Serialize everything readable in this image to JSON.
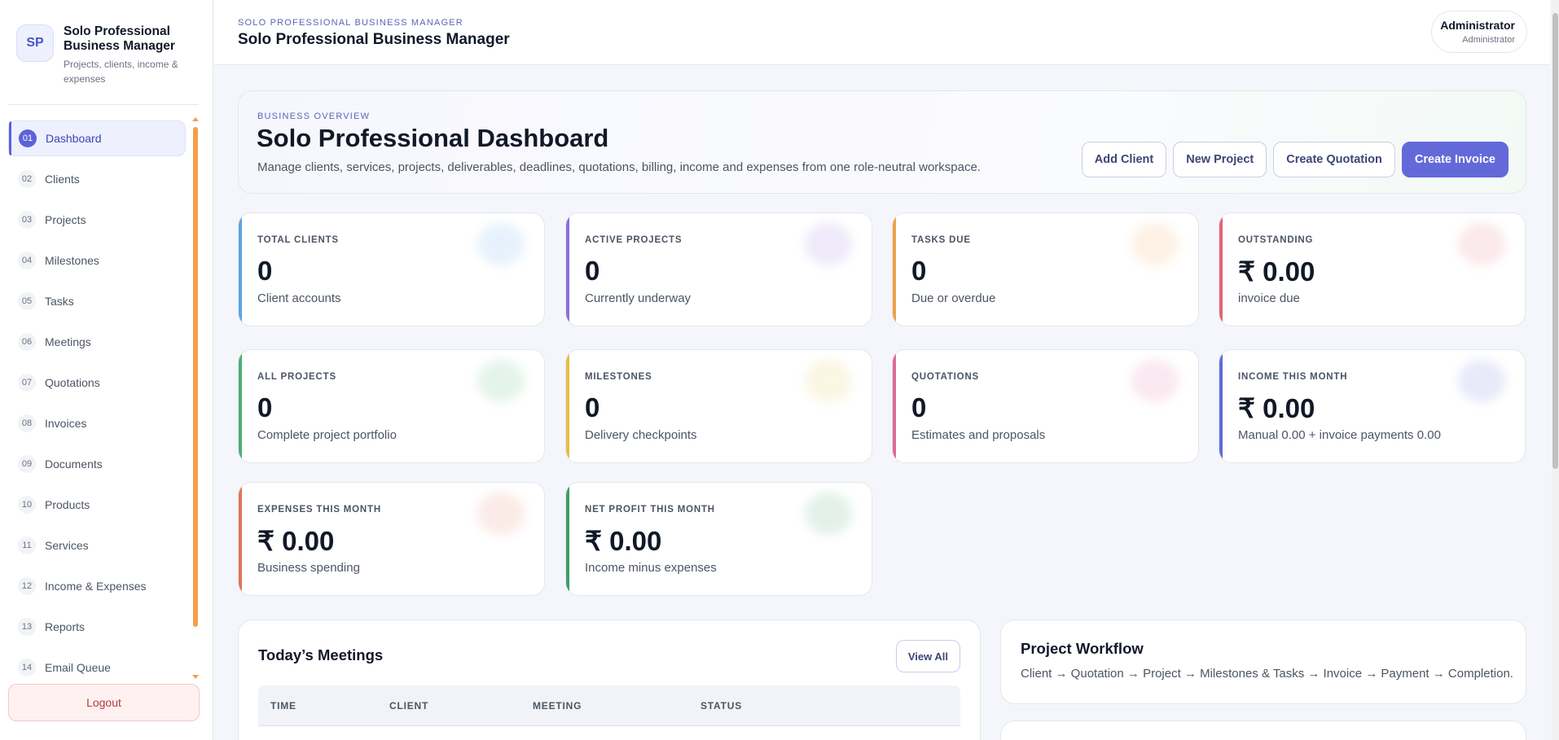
{
  "brand": {
    "initials": "SP",
    "title": "Solo Professional Business Manager",
    "subtitle": "Projects, clients, income & expenses"
  },
  "nav": [
    {
      "num": "01",
      "label": "Dashboard",
      "active": true
    },
    {
      "num": "02",
      "label": "Clients"
    },
    {
      "num": "03",
      "label": "Projects"
    },
    {
      "num": "04",
      "label": "Milestones"
    },
    {
      "num": "05",
      "label": "Tasks"
    },
    {
      "num": "06",
      "label": "Meetings"
    },
    {
      "num": "07",
      "label": "Quotations"
    },
    {
      "num": "08",
      "label": "Invoices"
    },
    {
      "num": "09",
      "label": "Documents"
    },
    {
      "num": "10",
      "label": "Products"
    },
    {
      "num": "11",
      "label": "Services"
    },
    {
      "num": "12",
      "label": "Income & Expenses"
    },
    {
      "num": "13",
      "label": "Reports"
    },
    {
      "num": "14",
      "label": "Email Queue"
    }
  ],
  "logout_label": "Logout",
  "topbar": {
    "eyebrow": "SOLO PROFESSIONAL BUSINESS MANAGER",
    "title": "Solo Professional Business Manager",
    "user_name": "Administrator",
    "user_role": "Administrator"
  },
  "hero": {
    "eyebrow": "BUSINESS OVERVIEW",
    "title": "Solo Professional Dashboard",
    "description": "Manage clients, services, projects, deliverables, deadlines, quotations, billing, income and expenses from one role-neutral workspace.",
    "actions": {
      "add_client": "Add Client",
      "new_project": "New Project",
      "create_quotation": "Create Quotation",
      "create_invoice": "Create Invoice"
    }
  },
  "stats": [
    {
      "key": "total-clients",
      "label": "TOTAL CLIENTS",
      "value": "0",
      "sub": "Client accounts",
      "color": "#5aa5e6"
    },
    {
      "key": "active-projects",
      "label": "ACTIVE PROJECTS",
      "value": "0",
      "sub": "Currently underway",
      "color": "#8b6fd9"
    },
    {
      "key": "tasks-due",
      "label": "TASKS DUE",
      "value": "0",
      "sub": "Due or overdue",
      "color": "#f0a04b"
    },
    {
      "key": "outstanding",
      "label": "OUTSTANDING",
      "value": "₹ 0.00",
      "sub": "invoice due",
      "color": "#e06477"
    },
    {
      "key": "all-projects",
      "label": "ALL PROJECTS",
      "value": "0",
      "sub": "Complete project portfolio",
      "color": "#4caf72"
    },
    {
      "key": "milestones",
      "label": "MILESTONES",
      "value": "0",
      "sub": "Delivery checkpoints",
      "color": "#e5be45"
    },
    {
      "key": "quotations",
      "label": "QUOTATIONS",
      "value": "0",
      "sub": "Estimates and proposals",
      "color": "#e0679a"
    },
    {
      "key": "income-this-month",
      "label": "INCOME THIS MONTH",
      "value": "₹ 0.00",
      "sub": "Manual 0.00 + invoice payments 0.00",
      "color": "#5f6bd8"
    },
    {
      "key": "expenses-this-month",
      "label": "EXPENSES THIS MONTH",
      "value": "₹ 0.00",
      "sub": "Business spending",
      "color": "#e0755a"
    },
    {
      "key": "net-profit-this-month",
      "label": "NET PROFIT THIS MONTH",
      "value": "₹ 0.00",
      "sub": "Income minus expenses",
      "color": "#3f9e69"
    }
  ],
  "meetings": {
    "title": "Today’s Meetings",
    "view_all": "View All",
    "columns": [
      "TIME",
      "CLIENT",
      "MEETING",
      "STATUS"
    ]
  },
  "workflow": {
    "title": "Project Workflow",
    "text": "Client → Quotation → Project → Milestones & Tasks → Invoice → Payment → Completion."
  }
}
